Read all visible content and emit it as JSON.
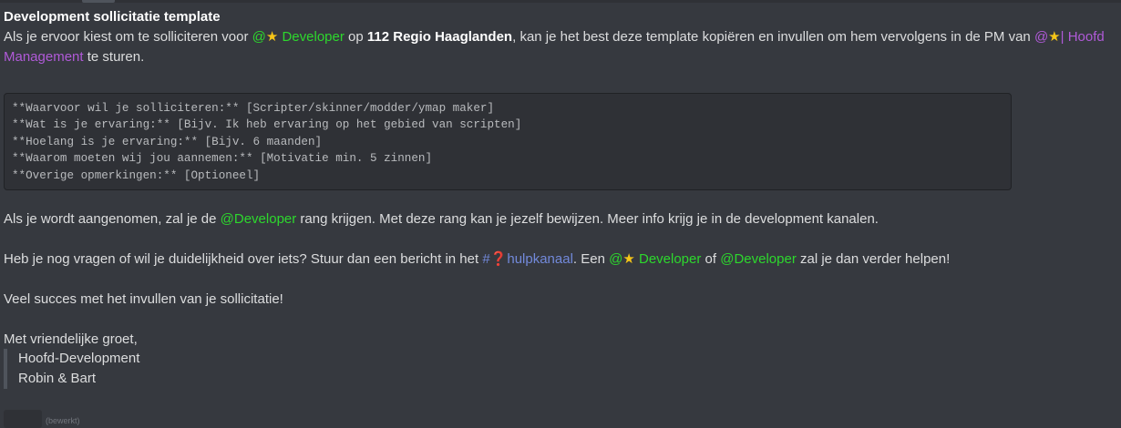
{
  "message": {
    "title": "Development sollicitatie template",
    "intro": {
      "part1": "Als je ervoor kiest om te solliciteren voor ",
      "mention_dev_prefix": "@",
      "mention_dev_star": "★",
      "mention_dev_label": " Developer",
      "part2": " op ",
      "location": "112 Regio Haaglanden",
      "part3": ", kan je het best deze template kopiëren en invullen om hem vervolgens in de PM van ",
      "mention_mgmt_prefix": "@",
      "mention_mgmt_star": "★",
      "mention_mgmt_label_line1": "| Hoofd",
      "mention_mgmt_label_line2": "Management",
      "part4": " te sturen."
    },
    "code_lines": [
      "**Waarvoor wil je solliciteren:** [Scripter/skinner/modder/ymap maker]",
      "**Wat is je ervaring:** [Bijv. Ik heb ervaring op het gebied van scripten]",
      "**Hoelang is je ervaring:** [Bijv. 6 maanden]",
      "**Waarom moeten wij jou aannemen:** [Motivatie min. 5 zinnen]",
      "**Overige opmerkingen:** [Optioneel]"
    ],
    "accepted": {
      "part1": "Als je wordt aangenomen, zal je de ",
      "mention": "@Developer",
      "part2": " rang krijgen. Met deze rang kan je jezelf bewijzen. Meer info krijg je in de development kanalen."
    },
    "questions": {
      "part1": "Heb je nog vragen of wil je duidelijkheid over iets? Stuur dan een bericht in het ",
      "channel_hash": "#",
      "channel_icon": "❓",
      "channel_name": "hulpkanaal",
      "part2": ". Een ",
      "mention1_prefix": "@",
      "mention1_star": "★",
      "mention1_label": " Developer",
      "part3": " of ",
      "mention2": "@Developer",
      "part4": " zal je dan verder helpen!"
    },
    "good_luck": "Veel succes met het invullen van je sollicitatie!",
    "greeting": "Met vriendelijke groet,",
    "signature": [
      "Hoofd-Development",
      "Robin & Bart"
    ],
    "edited_label": "(bewerkt)"
  },
  "colors": {
    "background": "#36393f",
    "text": "#dcddde",
    "mention_green": "#2dd82d",
    "mention_purple": "#b05ad8",
    "channel_blue": "#7289da",
    "code_background": "#2f3136"
  }
}
